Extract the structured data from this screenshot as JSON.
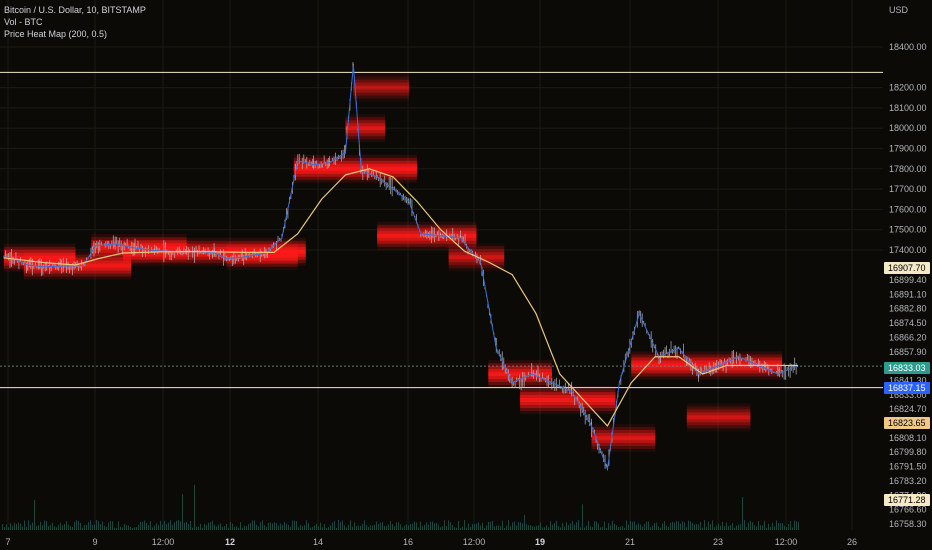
{
  "legend": {
    "symbol": "Bitcoin / U.S. Dollar, 10, BITSTAMP",
    "volume": "Vol - BTC",
    "indicator": "Price Heat Map (200, 0.5)"
  },
  "chart_data": {
    "type": "candlestick-heatmap",
    "currency_label": "USD",
    "price_axis_top": [
      {
        "label": "18400.00",
        "value": 18400
      },
      {
        "label": "18200.00",
        "value": 18200
      },
      {
        "label": "18100.00",
        "value": 18100
      },
      {
        "label": "18000.00",
        "value": 18000
      },
      {
        "label": "17900.00",
        "value": 17900
      },
      {
        "label": "17800.00",
        "value": 17800
      },
      {
        "label": "17700.00",
        "value": 17700
      },
      {
        "label": "17600.00",
        "value": 17600
      },
      {
        "label": "17500.00",
        "value": 17500
      },
      {
        "label": "17400.00",
        "value": 17400
      }
    ],
    "price_axis_bottom": [
      "16899.40",
      "16891.10",
      "16882.80",
      "16874.50",
      "16866.20",
      "16857.90",
      "16849.60",
      "16841.30",
      "16833.00",
      "16824.70",
      "16816.40",
      "16808.10",
      "16799.80",
      "16791.50",
      "16783.20",
      "16774.90",
      "16766.60",
      "16758.30"
    ],
    "price_tags": [
      {
        "label": "16907.70",
        "bg": "#f5e9c8",
        "fg": "#000000",
        "row": "upper-line"
      },
      {
        "label": "16833.03",
        "bg": "#2a9d8f",
        "fg": "#ffffff",
        "row": "last"
      },
      {
        "label": "16837.15",
        "bg": "#2962ff",
        "fg": "#ffffff",
        "row": "lower-line"
      },
      {
        "label": "16823.65",
        "bg": "#f0c987",
        "fg": "#000000",
        "row": "mid"
      },
      {
        "label": "16771.28",
        "bg": "#f5e9c8",
        "fg": "#000000",
        "row": "low"
      }
    ],
    "time_axis": [
      {
        "label": "7",
        "bold": false
      },
      {
        "label": "9",
        "bold": false
      },
      {
        "label": "12:00",
        "bold": false
      },
      {
        "label": "12",
        "bold": true
      },
      {
        "label": "14",
        "bold": false
      },
      {
        "label": "16",
        "bold": false
      },
      {
        "label": "12:00",
        "bold": false
      },
      {
        "label": "19",
        "bold": true
      },
      {
        "label": "21",
        "bold": false
      },
      {
        "label": "23",
        "bold": false
      },
      {
        "label": "12:00",
        "bold": false
      },
      {
        "label": "26",
        "bold": false
      }
    ],
    "price_series": [
      {
        "t": 0.0,
        "p": 17290
      },
      {
        "t": 0.3,
        "p": 17240
      },
      {
        "t": 0.6,
        "p": 17150
      },
      {
        "t": 1.0,
        "p": 17120
      },
      {
        "t": 1.5,
        "p": 17130
      },
      {
        "t": 2.0,
        "p": 17140
      },
      {
        "t": 2.3,
        "p": 17420
      },
      {
        "t": 2.8,
        "p": 17430
      },
      {
        "t": 3.3,
        "p": 17410
      },
      {
        "t": 3.8,
        "p": 17390
      },
      {
        "t": 4.3,
        "p": 17375
      },
      {
        "t": 4.8,
        "p": 17370
      },
      {
        "t": 5.3,
        "p": 17355
      },
      {
        "t": 5.6,
        "p": 17260
      },
      {
        "t": 6.0,
        "p": 17280
      },
      {
        "t": 6.6,
        "p": 17350
      },
      {
        "t": 7.0,
        "p": 17460
      },
      {
        "t": 7.4,
        "p": 17840
      },
      {
        "t": 7.8,
        "p": 17820
      },
      {
        "t": 8.2,
        "p": 17830
      },
      {
        "t": 8.6,
        "p": 17880
      },
      {
        "t": 8.8,
        "p": 18310
      },
      {
        "t": 9.0,
        "p": 17790
      },
      {
        "t": 9.4,
        "p": 17760
      },
      {
        "t": 9.8,
        "p": 17700
      },
      {
        "t": 10.2,
        "p": 17640
      },
      {
        "t": 10.5,
        "p": 17480
      },
      {
        "t": 11.0,
        "p": 17470
      },
      {
        "t": 11.5,
        "p": 17460
      },
      {
        "t": 11.8,
        "p": 17340
      },
      {
        "t": 12.0,
        "p": 17210
      },
      {
        "t": 12.4,
        "p": 16860
      },
      {
        "t": 12.8,
        "p": 16840
      },
      {
        "t": 13.3,
        "p": 16845
      },
      {
        "t": 13.8,
        "p": 16840
      },
      {
        "t": 14.3,
        "p": 16835
      },
      {
        "t": 14.8,
        "p": 16815
      },
      {
        "t": 15.2,
        "p": 16790
      },
      {
        "t": 15.5,
        "p": 16840
      },
      {
        "t": 16.0,
        "p": 16880
      },
      {
        "t": 16.5,
        "p": 16855
      },
      {
        "t": 17.0,
        "p": 16860
      },
      {
        "t": 17.5,
        "p": 16845
      },
      {
        "t": 18.0,
        "p": 16850
      },
      {
        "t": 18.5,
        "p": 16855
      },
      {
        "t": 19.0,
        "p": 16850
      },
      {
        "t": 19.5,
        "p": 16845
      },
      {
        "t": 20.0,
        "p": 16850
      }
    ],
    "moving_average": [
      {
        "t": 0.0,
        "p": 17270
      },
      {
        "t": 1.0,
        "p": 17190
      },
      {
        "t": 1.8,
        "p": 17150
      },
      {
        "t": 2.4,
        "p": 17260
      },
      {
        "t": 3.0,
        "p": 17350
      },
      {
        "t": 4.0,
        "p": 17370
      },
      {
        "t": 5.0,
        "p": 17375
      },
      {
        "t": 6.0,
        "p": 17360
      },
      {
        "t": 6.8,
        "p": 17360
      },
      {
        "t": 7.4,
        "p": 17480
      },
      {
        "t": 8.0,
        "p": 17650
      },
      {
        "t": 8.6,
        "p": 17770
      },
      {
        "t": 9.2,
        "p": 17800
      },
      {
        "t": 9.8,
        "p": 17760
      },
      {
        "t": 10.4,
        "p": 17640
      },
      {
        "t": 11.0,
        "p": 17500
      },
      {
        "t": 11.6,
        "p": 17380
      },
      {
        "t": 12.2,
        "p": 17200
      },
      {
        "t": 12.8,
        "p": 16990
      },
      {
        "t": 13.4,
        "p": 16880
      },
      {
        "t": 14.0,
        "p": 16845
      },
      {
        "t": 14.6,
        "p": 16830
      },
      {
        "t": 15.2,
        "p": 16815
      },
      {
        "t": 15.8,
        "p": 16840
      },
      {
        "t": 16.4,
        "p": 16855
      },
      {
        "t": 17.0,
        "p": 16855
      },
      {
        "t": 17.6,
        "p": 16845
      },
      {
        "t": 18.2,
        "p": 16850
      },
      {
        "t": 19.0,
        "p": 16850
      },
      {
        "t": 20.0,
        "p": 16850
      }
    ],
    "heat_bands": [
      {
        "t0": 0.0,
        "t1": 1.8,
        "p": 17270,
        "strength": 0.9
      },
      {
        "t0": 0.5,
        "t1": 3.2,
        "p": 17140,
        "strength": 0.9
      },
      {
        "t0": 2.2,
        "t1": 4.6,
        "p": 17410,
        "strength": 0.8
      },
      {
        "t0": 3.0,
        "t1": 7.6,
        "p": 17370,
        "strength": 1.0
      },
      {
        "t0": 5.6,
        "t1": 7.4,
        "p": 17300,
        "strength": 0.7
      },
      {
        "t0": 7.3,
        "t1": 10.4,
        "p": 17800,
        "strength": 1.0
      },
      {
        "t0": 8.6,
        "t1": 9.6,
        "p": 18000,
        "strength": 0.7
      },
      {
        "t0": 8.8,
        "t1": 10.2,
        "p": 18200,
        "strength": 0.5
      },
      {
        "t0": 9.4,
        "t1": 11.9,
        "p": 17470,
        "strength": 0.9
      },
      {
        "t0": 11.2,
        "t1": 12.6,
        "p": 17280,
        "strength": 0.6
      },
      {
        "t0": 12.2,
        "t1": 13.8,
        "p": 16845,
        "strength": 0.9
      },
      {
        "t0": 13.0,
        "t1": 15.4,
        "p": 16830,
        "strength": 0.9
      },
      {
        "t0": 14.8,
        "t1": 16.4,
        "p": 16808,
        "strength": 0.7
      },
      {
        "t0": 15.8,
        "t1": 19.6,
        "p": 16850,
        "strength": 1.0
      },
      {
        "t0": 17.2,
        "t1": 18.8,
        "p": 16820,
        "strength": 0.6
      }
    ],
    "horizontal_levels": [
      {
        "name": "upper-line",
        "p": 18275,
        "color": "#f5e9c8"
      },
      {
        "name": "lower-line",
        "p": 16837.15,
        "color": "#f5e9c8"
      }
    ]
  }
}
